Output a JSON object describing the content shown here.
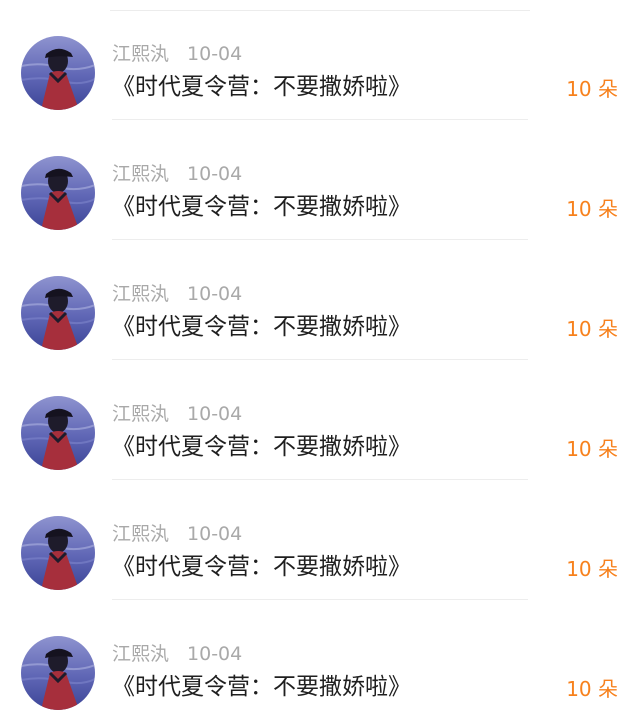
{
  "items": [
    {
      "name": "江熙汍",
      "date": "10-04",
      "title": "《时代夏令营：不要撒娇啦》",
      "count": "10 朵"
    },
    {
      "name": "江熙汍",
      "date": "10-04",
      "title": "《时代夏令营：不要撒娇啦》",
      "count": "10 朵"
    },
    {
      "name": "江熙汍",
      "date": "10-04",
      "title": "《时代夏令营：不要撒娇啦》",
      "count": "10 朵"
    },
    {
      "name": "江熙汍",
      "date": "10-04",
      "title": "《时代夏令营：不要撒娇啦》",
      "count": "10 朵"
    },
    {
      "name": "江熙汍",
      "date": "10-04",
      "title": "《时代夏令营：不要撒娇啦》",
      "count": "10 朵"
    },
    {
      "name": "江熙汍",
      "date": "10-04",
      "title": "《时代夏令营：不要撒娇啦》",
      "count": "10 朵"
    }
  ],
  "colors": {
    "accent": "#f7811d",
    "meta_text": "#a9a9a9",
    "title_text": "#1f1f1f",
    "divider": "#ededed"
  },
  "icons": {
    "avatar": "profile-photo-icon"
  }
}
